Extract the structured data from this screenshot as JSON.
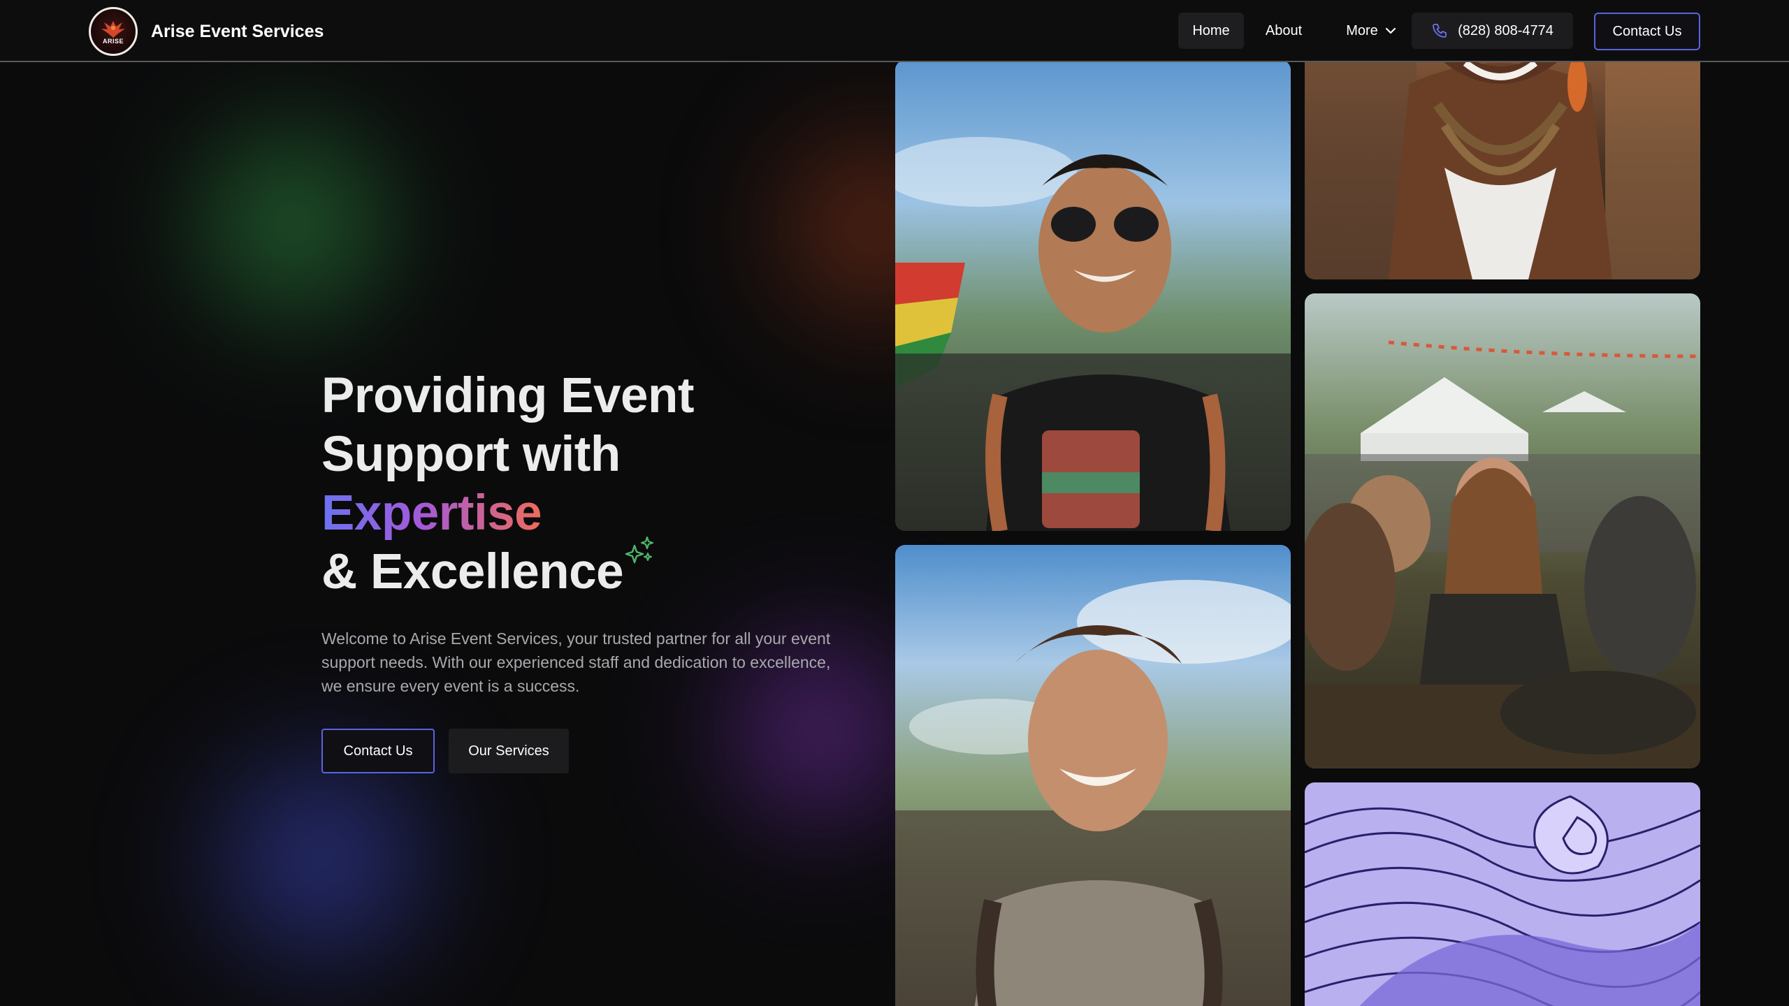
{
  "header": {
    "brand_name": "Arise Event Services",
    "logo_text": "ARISE",
    "nav": {
      "home": "Home",
      "about": "About",
      "more": "More",
      "phone": "(828) 808-4774",
      "contact": "Contact Us"
    }
  },
  "hero": {
    "title_part1": "Providing Event",
    "title_part2": "Support with ",
    "title_highlight": "Expertise",
    "title_part3": "& Excellence",
    "description": "Welcome to Arise Event Services, your trusted partner for all your event support needs. With our experienced staff and dedication to excellence, we ensure every event is a success.",
    "buttons": {
      "contact": "Contact Us",
      "services": "Our Services"
    }
  },
  "colors": {
    "accent_border": "#5a63e0",
    "gradient": [
      "#6b72f0",
      "#a35ad8",
      "#ef6b5c"
    ],
    "sparkle": "#4fb86a",
    "background": "#0b0b0c"
  },
  "icons": {
    "phone": "phone-icon",
    "more": "chevron-down-icon",
    "sparkle": "sparkle-icon"
  }
}
